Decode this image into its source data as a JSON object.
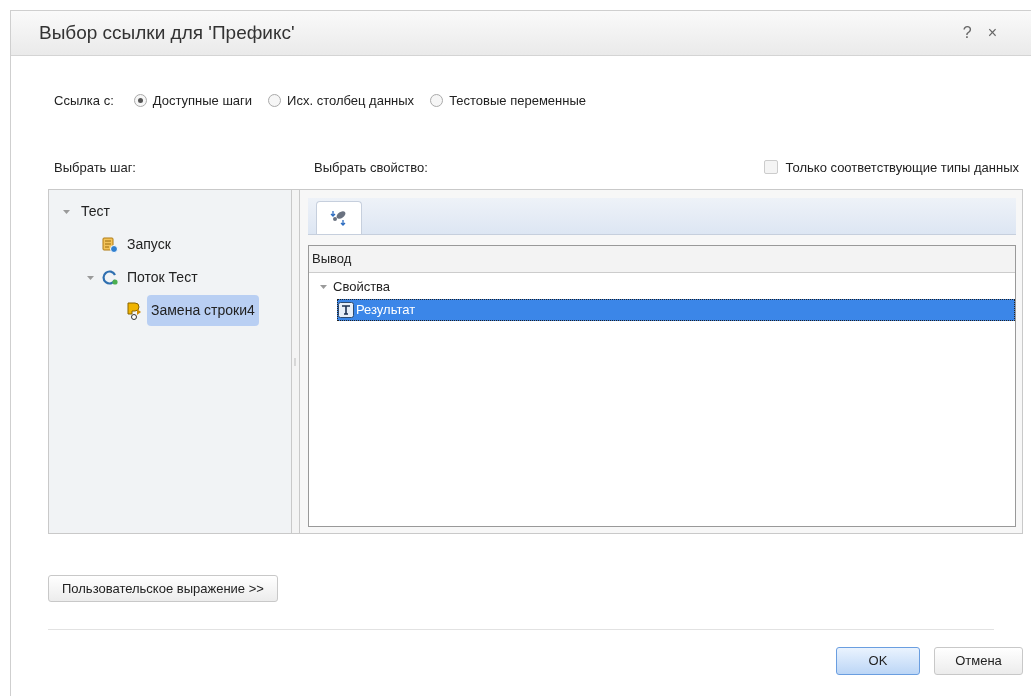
{
  "window": {
    "title": "Выбор ссылки для 'Префикс'",
    "help": "?",
    "close": "×"
  },
  "link_from": {
    "label": "Ссылка с:",
    "options": [
      {
        "label": "Доступные шаги",
        "selected": true
      },
      {
        "label": "Исх. столбец данных",
        "selected": false
      },
      {
        "label": "Тестовые переменные",
        "selected": false
      }
    ]
  },
  "step_panel": {
    "label": "Выбрать шаг:",
    "tree": [
      {
        "label": "Тест",
        "expanded": true,
        "selected": false,
        "children": [
          {
            "label": "Запуск",
            "kind": "launch",
            "selected": false
          },
          {
            "label": "Поток Тест",
            "kind": "flow",
            "expanded": true,
            "selected": false,
            "children": [
              {
                "label": "Замена строки4",
                "kind": "replace",
                "selected": true
              }
            ]
          }
        ]
      }
    ]
  },
  "property_panel": {
    "label": "Выбрать свойство:",
    "matching_types_only": {
      "label": "Только соответствующие типы данных",
      "checked": false
    },
    "column": "Вывод",
    "tree": [
      {
        "label": "Свойства",
        "expanded": true,
        "selected": false,
        "children": [
          {
            "label": "Результат",
            "selected": true
          }
        ]
      }
    ]
  },
  "custom_expression_button": "Пользовательское выражение >>",
  "buttons": [
    {
      "label": "OK",
      "kind": "primary"
    },
    {
      "label": "Отмена",
      "kind": "secondary"
    }
  ]
}
